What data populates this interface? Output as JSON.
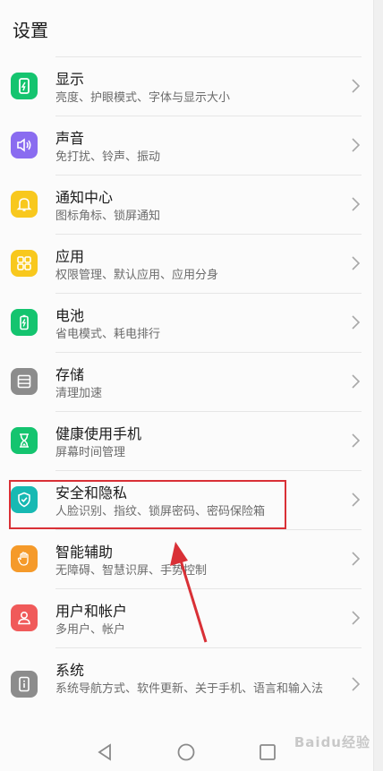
{
  "header": {
    "title": "设置"
  },
  "settings": [
    {
      "title": "显示",
      "subtitle": "亮度、护眼模式、字体与显示大小",
      "icon": "display-icon",
      "color": "#14c46f"
    },
    {
      "title": "声音",
      "subtitle": "免打扰、铃声、振动",
      "icon": "sound-icon",
      "color": "#8a6cf0"
    },
    {
      "title": "通知中心",
      "subtitle": "图标角标、锁屏通知",
      "icon": "bell-icon",
      "color": "#f8c81d"
    },
    {
      "title": "应用",
      "subtitle": "权限管理、默认应用、应用分身",
      "icon": "apps-grid-icon",
      "color": "#f8c81d"
    },
    {
      "title": "电池",
      "subtitle": "省电模式、耗电排行",
      "icon": "battery-icon",
      "color": "#14c46f"
    },
    {
      "title": "存储",
      "subtitle": "清理加速",
      "icon": "storage-icon",
      "color": "#8c8c8c"
    },
    {
      "title": "健康使用手机",
      "subtitle": "屏幕时间管理",
      "icon": "hourglass-icon",
      "color": "#14c46f"
    },
    {
      "title": "安全和隐私",
      "subtitle": "人脸识别、指纹、锁屏密码、密码保险箱",
      "icon": "shield-icon",
      "color": "#17b9b3"
    },
    {
      "title": "智能辅助",
      "subtitle": "无障碍、智慧识屏、手势控制",
      "icon": "hand-icon",
      "color": "#f59a2a"
    },
    {
      "title": "用户和帐户",
      "subtitle": "多用户、帐户",
      "icon": "user-icon",
      "color": "#f05a5a"
    },
    {
      "title": "系统",
      "subtitle": "系统导航方式、软件更新、关于手机、语言和输入法",
      "icon": "system-info-icon",
      "color": "#8c8c8c"
    }
  ],
  "watermark": "Baidu经验",
  "annotation_color": "#d93036"
}
